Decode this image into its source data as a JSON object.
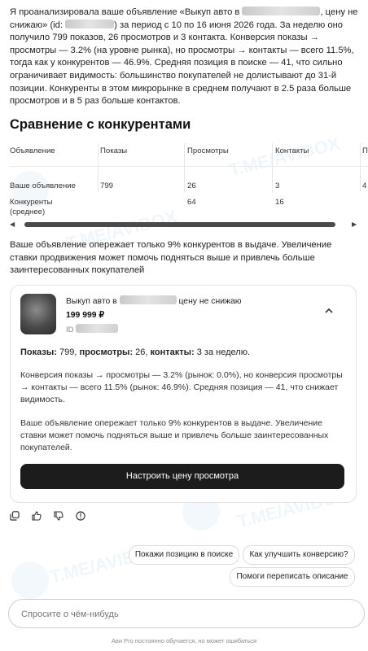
{
  "intro": {
    "before_title": "Я проанализировала ваше объявление «Выкуп авто в ",
    "title_tail": ", цену не снижаю» (id: ",
    "id_tail": ") за период с 10 по 16 июня 2026 года. За неделю оно получило 799 показов, 26 просмотров и 3 контакта. Конверсия показы → просмотры — 3.2% (на уровне рынка), но просмотры → контакты — всего 11.5%, тогда как у конкурентов — 46.9%. Средняя позиция в поиске — 41, что сильно ограничивает видимость: большинство покупателей не долистывают до 31-й позиции. Конкуренты в этом микрорынке в среднем получают в 2.5 раза больше просмотров и в 5 раз больше контактов."
  },
  "comparison": {
    "heading": "Сравнение с конкурентами",
    "columns": [
      "Объявление",
      "Показы",
      "Просмотры",
      "Контакты",
      "П"
    ],
    "rows": [
      [
        "Ваше объявление",
        "799",
        "26",
        "3",
        "4"
      ],
      [
        "Конкуренты (среднее)",
        "",
        "64",
        "16",
        ""
      ]
    ]
  },
  "summary": "Ваше объявление опережает только 9% конкурентов в выдаче. Увеличение ставки продвижения может помочь подняться выше и привлечь больше заинтересованных покупателей",
  "card": {
    "title_start": "Выкуп авто в ",
    "title_end": "цену не снижаю",
    "price": "199 999 ₽",
    "id_label": "ID",
    "stats": {
      "views_label": "Показы:",
      "views_value": " 799, ",
      "looks_label": "просмотры:",
      "looks_value": " 26, ",
      "contacts_label": "контакты:",
      "contacts_value": " 3 за неделю."
    },
    "conversion": "Конверсия показы → просмотры — 3.2% (рынок: 0.0%), но конверсия просмотры → контакты — всего 11.5% (рынок: 46.9%). Средняя позиция — 41, что снижает видимость.",
    "summary": "Ваше объявление опережает только 9% конкурентов в выдаче. Увеличение ставки может помочь подняться выше и привлечь больше заинтересованных покупателей.",
    "button_label": "Настроить цену просмотра"
  },
  "actions": [
    "copy-icon",
    "thumbs-up-icon",
    "thumbs-down-icon",
    "info-icon"
  ],
  "suggestions": [
    "Покажи позицию в поиске",
    "Как улучшить конверсию?",
    "Помоги переписать описание"
  ],
  "chat": {
    "placeholder": "Спросите о чём-нибудь"
  },
  "footer": "Ави Pro постоянно обучается, но может ошибаться",
  "watermark": "T.ME/AVIBOX",
  "colors": {
    "button": "#1c1c1c",
    "watermark": "#2b8fd6",
    "border": "#e3e3e3"
  }
}
